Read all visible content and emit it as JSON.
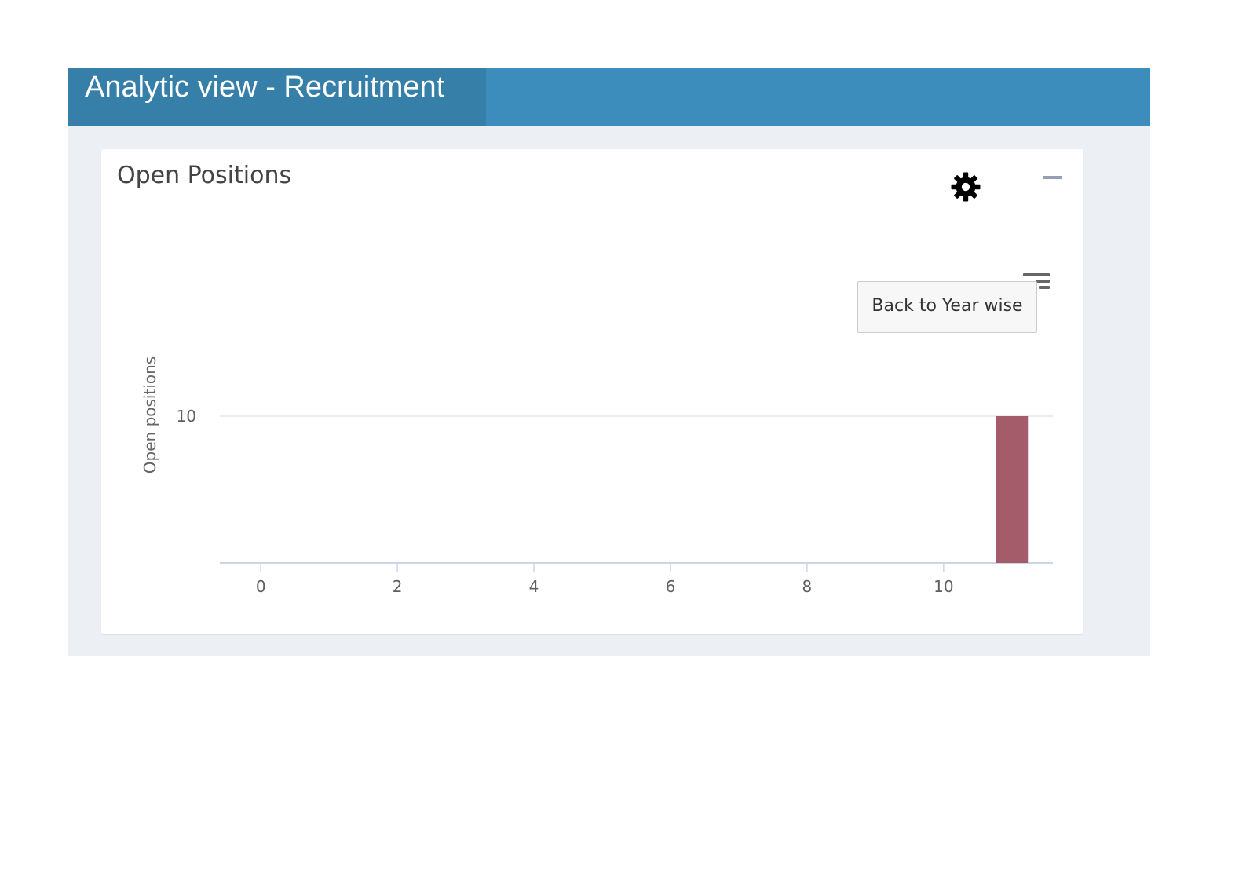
{
  "header": {
    "title": "Analytic view - Recruitment"
  },
  "card": {
    "title": "Open Positions",
    "settings_icon": "gear-icon",
    "collapse_icon": "minus-icon",
    "menu_icon": "hamburger-menu-icon",
    "back_button_label": "Back to Year wise"
  },
  "colors": {
    "header_bg": "#3c8dbc",
    "header_title_bg": "#367fa9",
    "content_bg": "#ecf0f5",
    "bar": "#a55c6a"
  },
  "chart_data": {
    "type": "bar",
    "title": "",
    "xlabel": "",
    "ylabel": "Open positions",
    "x_ticks": [
      0,
      2,
      4,
      6,
      8,
      10
    ],
    "y_ticks": [
      10
    ],
    "xlim": [
      -0.6,
      11.6
    ],
    "ylim": [
      0,
      10
    ],
    "grid": true,
    "series": [
      {
        "x": [
          11
        ],
        "values": [
          10
        ]
      }
    ]
  }
}
